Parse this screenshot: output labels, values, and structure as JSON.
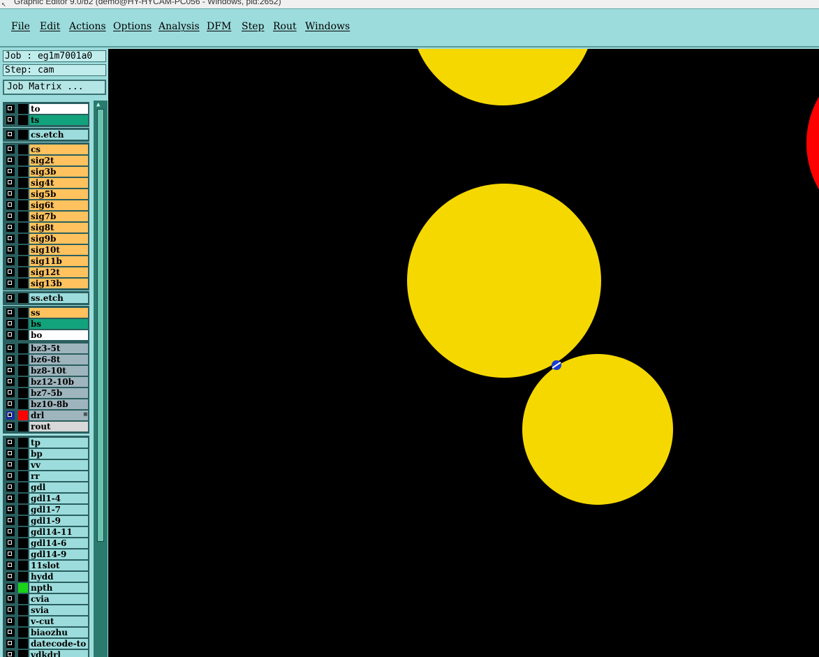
{
  "window": {
    "title": "Graphic Editor 9.0/b2 (demo@HY-HYCAM-PC056 - Windows, pid:2652)"
  },
  "menu": {
    "items": [
      "File",
      "Edit",
      "Actions",
      "Options",
      "Analysis",
      "DFM",
      "Step",
      "Rout",
      "Windows"
    ]
  },
  "job": {
    "label": "Job : eg1m7001a0"
  },
  "step": {
    "label": "Step: cam"
  },
  "job_matrix_button": "Job Matrix ...",
  "layers": [
    {
      "name": "to",
      "color": "#ffffff",
      "group": 0
    },
    {
      "name": "ts",
      "color": "#12a37c",
      "group": 0
    },
    {
      "name": "cs.etch",
      "color": "#9ddcdc",
      "group": 1
    },
    {
      "name": "cs",
      "color": "#ffc25e",
      "group": 2
    },
    {
      "name": "sig2t",
      "color": "#ffc25e",
      "group": 2
    },
    {
      "name": "sig3b",
      "color": "#ffc25e",
      "group": 2
    },
    {
      "name": "sig4t",
      "color": "#ffc25e",
      "group": 2
    },
    {
      "name": "sig5b",
      "color": "#ffc25e",
      "group": 2
    },
    {
      "name": "sig6t",
      "color": "#ffc25e",
      "group": 2
    },
    {
      "name": "sig7b",
      "color": "#ffc25e",
      "group": 2
    },
    {
      "name": "sig8t",
      "color": "#ffc25e",
      "group": 2
    },
    {
      "name": "sig9b",
      "color": "#ffc25e",
      "group": 2
    },
    {
      "name": "sig10t",
      "color": "#ffc25e",
      "group": 2
    },
    {
      "name": "sig11b",
      "color": "#ffc25e",
      "group": 2
    },
    {
      "name": "sig12t",
      "color": "#ffc25e",
      "group": 2
    },
    {
      "name": "sig13b",
      "color": "#ffc25e",
      "group": 2
    },
    {
      "name": "ss.etch",
      "color": "#9ddcdc",
      "group": 3
    },
    {
      "name": "ss",
      "color": "#ffc25e",
      "group": 4
    },
    {
      "name": "bs",
      "color": "#12a37c",
      "group": 4
    },
    {
      "name": "bo",
      "color": "#ffffff",
      "group": 4
    },
    {
      "name": "bz3-5t",
      "color": "#9fb5bd",
      "group": 5
    },
    {
      "name": "bz6-8t",
      "color": "#9fb5bd",
      "group": 5
    },
    {
      "name": "bz8-10t",
      "color": "#9fb5bd",
      "group": 5
    },
    {
      "name": "bz12-10b",
      "color": "#9fb5bd",
      "group": 5
    },
    {
      "name": "bz7-5b",
      "color": "#9fb5bd",
      "group": 5
    },
    {
      "name": "bz10-8b",
      "color": "#9fb5bd",
      "group": 5
    },
    {
      "name": "drl",
      "color": "#9fb5bd",
      "group": 5,
      "active": true,
      "swatch": "#ff0000",
      "flag": "⊞"
    },
    {
      "name": "rout",
      "color": "#d8d8d8",
      "group": 5
    },
    {
      "name": "tp",
      "color": "#9ddcdc",
      "group": 6
    },
    {
      "name": "bp",
      "color": "#9ddcdc",
      "group": 6
    },
    {
      "name": "vv",
      "color": "#9ddcdc",
      "group": 6
    },
    {
      "name": "rr",
      "color": "#9ddcdc",
      "group": 6
    },
    {
      "name": "gdl",
      "color": "#9ddcdc",
      "group": 6
    },
    {
      "name": "gdl1-4",
      "color": "#9ddcdc",
      "group": 6
    },
    {
      "name": "gdl1-7",
      "color": "#9ddcdc",
      "group": 6
    },
    {
      "name": "gdl1-9",
      "color": "#9ddcdc",
      "group": 6
    },
    {
      "name": "gdl14-11",
      "color": "#9ddcdc",
      "group": 6
    },
    {
      "name": "gdl14-6",
      "color": "#9ddcdc",
      "group": 6
    },
    {
      "name": "gdl14-9",
      "color": "#9ddcdc",
      "group": 6
    },
    {
      "name": "11slot",
      "color": "#9ddcdc",
      "group": 6
    },
    {
      "name": "hydd",
      "color": "#9ddcdc",
      "group": 6
    },
    {
      "name": "npth",
      "color": "#9ddcdc",
      "group": 6,
      "swatch": "#19d219"
    },
    {
      "name": "cvia",
      "color": "#9ddcdc",
      "group": 6
    },
    {
      "name": "svia",
      "color": "#9ddcdc",
      "group": 6
    },
    {
      "name": "v-cut",
      "color": "#9ddcdc",
      "group": 6
    },
    {
      "name": "biaozhu",
      "color": "#9ddcdc",
      "group": 6
    },
    {
      "name": "datecode-to",
      "color": "#9ddcdc",
      "group": 6
    },
    {
      "name": "vdkdrl",
      "color": "#9ddcdc",
      "group": 6
    }
  ],
  "canvas": {
    "background": "#000000",
    "pad_color": "#f5d800",
    "highlight_color": "#ff0000",
    "marker_color": "#1a3ed8"
  }
}
